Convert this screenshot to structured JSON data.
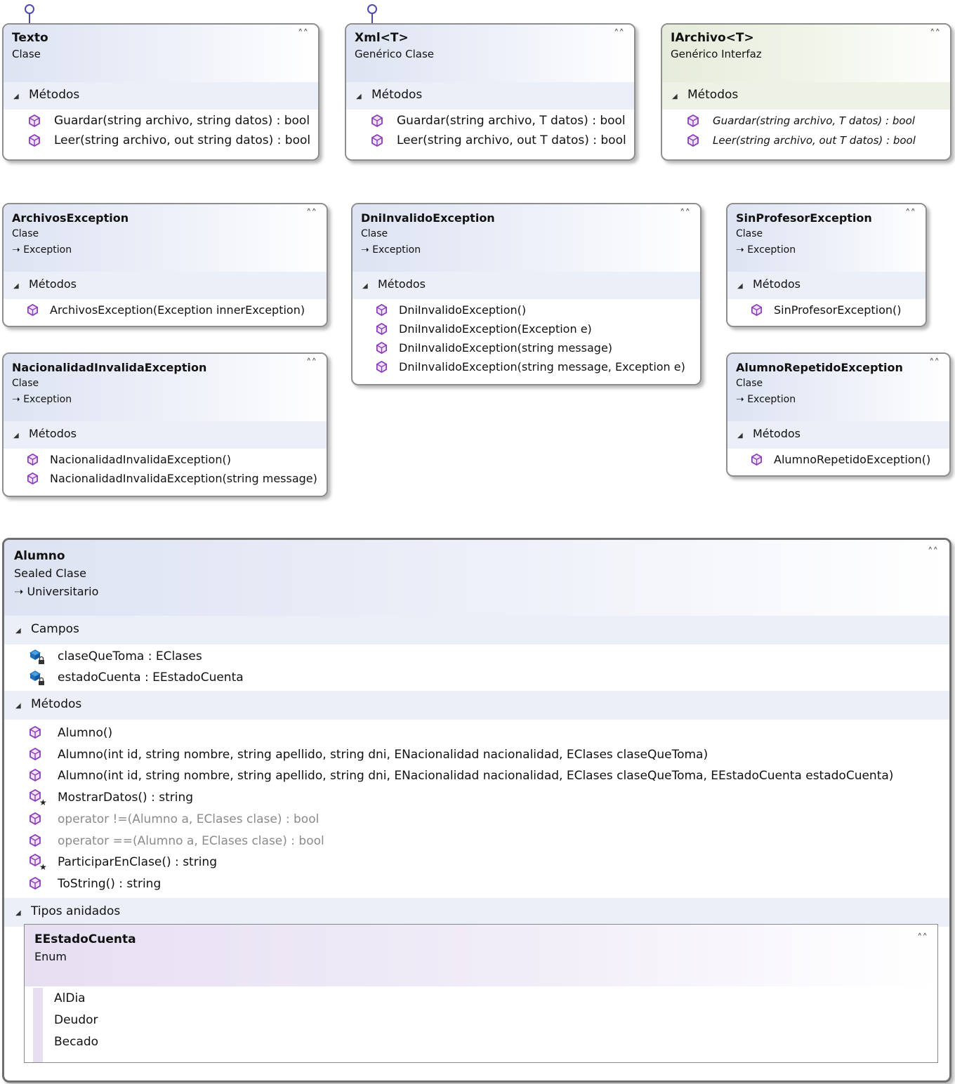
{
  "texto": {
    "name": "Texto",
    "kind": "Clase",
    "section": "Métodos",
    "members": [
      "Guardar(string archivo, string datos) : bool",
      "Leer(string archivo, out string datos) : bool"
    ]
  },
  "xml": {
    "name": "Xml<T>",
    "kind": "Genérico Clase",
    "section": "Métodos",
    "members": [
      "Guardar(string archivo, T datos) : bool",
      "Leer(string archivo, out T datos) : bool"
    ]
  },
  "iarchivo": {
    "name": "IArchivo<T>",
    "kind": "Genérico Interfaz",
    "section": "Métodos",
    "members": [
      "Guardar(string archivo, T datos) : bool",
      "Leer(string archivo, out T datos) : bool"
    ]
  },
  "archivosEx": {
    "name": "ArchivosException",
    "kind": "Clase",
    "base": "Exception",
    "section": "Métodos",
    "members": [
      "ArchivosException(Exception innerException)"
    ]
  },
  "dniEx": {
    "name": "DniInvalidoException",
    "kind": "Clase",
    "base": "Exception",
    "section": "Métodos",
    "members": [
      "DniInvalidoException()",
      "DniInvalidoException(Exception e)",
      "DniInvalidoException(string message)",
      "DniInvalidoException(string message, Exception e)"
    ]
  },
  "sinProfEx": {
    "name": "SinProfesorException",
    "kind": "Clase",
    "base": "Exception",
    "section": "Métodos",
    "members": [
      "SinProfesorException()"
    ]
  },
  "nacEx": {
    "name": "NacionalidadInvalidaException",
    "kind": "Clase",
    "base": "Exception",
    "section": "Métodos",
    "members": [
      "NacionalidadInvalidaException()",
      "NacionalidadInvalidaException(string message)"
    ]
  },
  "alumnoRepEx": {
    "name": "AlumnoRepetidoException",
    "kind": "Clase",
    "base": "Exception",
    "section": "Métodos",
    "members": [
      "AlumnoRepetidoException()"
    ]
  },
  "alumno": {
    "name": "Alumno",
    "kind": "Sealed Clase",
    "base": "Universitario",
    "fieldsSection": "Campos",
    "fields": [
      "claseQueToma : EClases",
      "estadoCuenta : EEstadoCuenta"
    ],
    "methodsSection": "Métodos",
    "methods": [
      "Alumno()",
      "Alumno(int id, string nombre, string apellido, string dni, ENacionalidad nacionalidad, EClases claseQueToma)",
      "Alumno(int id, string nombre, string apellido, string dni, ENacionalidad nacionalidad, EClases claseQueToma, EEstadoCuenta estadoCuenta)",
      "MostrarDatos() : string",
      "operator !=(Alumno a, EClases clase) : bool",
      "operator ==(Alumno a, EClases clase) : bool",
      "ParticiparEnClase() : string",
      "ToString() : string"
    ],
    "nestedSection": "Tipos anidados",
    "nested": {
      "name": "EEstadoCuenta",
      "kind": "Enum",
      "values": [
        "AlDia",
        "Deudor",
        "Becado"
      ]
    }
  },
  "icons": {
    "method": "method-cube-icon",
    "field": "private-field-icon",
    "override": "override-star-icon",
    "collapse": "double-chevron-up-icon",
    "inherit": "arrow-inherit-icon"
  },
  "colors": {
    "header": "#dde3f2",
    "interfaceHeader": "#e6ecdb",
    "enumHeader": "#e6dff2",
    "section": "#ebeff7",
    "methodIcon": "#8a3cb8",
    "fieldIcon": "#1e6fb8",
    "lollipop": "#4c4ab0"
  }
}
